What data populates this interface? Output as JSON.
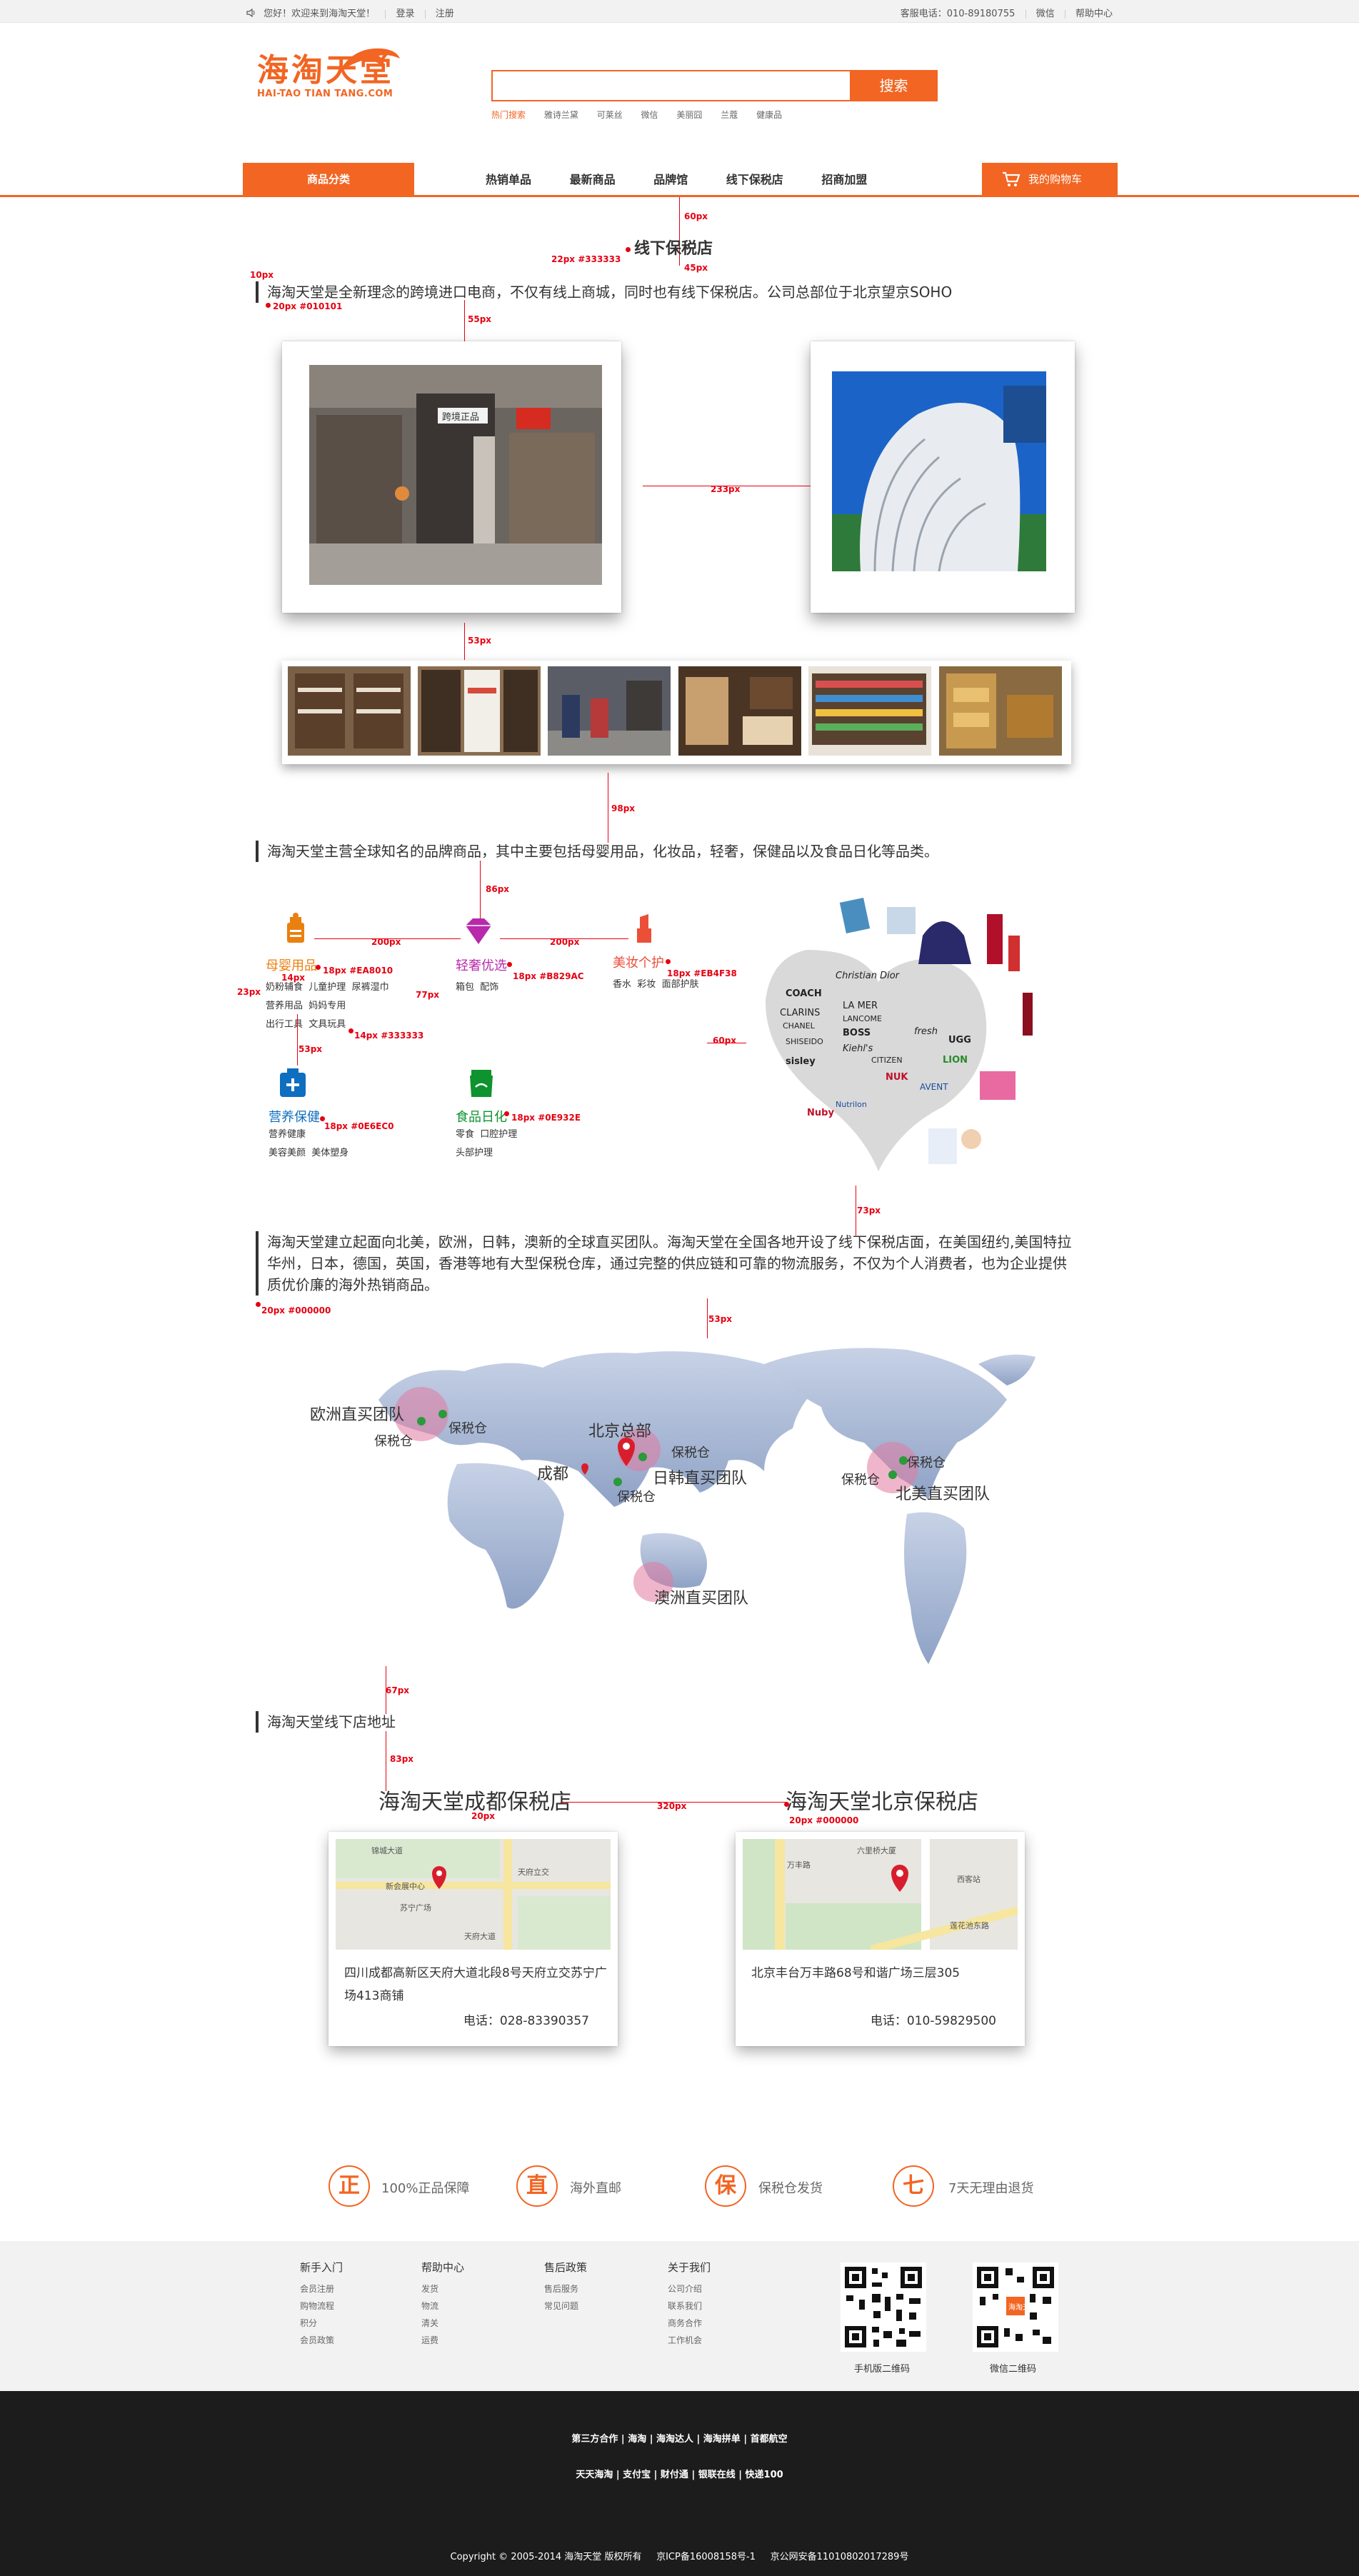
{
  "topbar": {
    "welcome": "您好！欢迎来到海淘天堂！",
    "login": "登录",
    "register": "注册",
    "service": "客服电话：010-89180755",
    "weixin": "微信",
    "help": "帮助中心"
  },
  "header": {
    "logo_text": "海淘天堂",
    "logo_sub": "HAI-TAO TIAN TANG.COM",
    "search_placeholder": "",
    "search_button": "搜索",
    "hot_words": [
      "热门搜索",
      "雅诗兰黛",
      "可莱丝",
      "微信",
      "美丽囧",
      "兰蔻",
      "健康品"
    ]
  },
  "nav": {
    "category": "商品分类",
    "items": [
      "热销单品",
      "最新商品",
      "品牌馆",
      "线下保税店",
      "招商加盟"
    ],
    "cart": "我的购物车"
  },
  "section1": {
    "title": "线下保税店",
    "intro": "海淘天堂是全新理念的跨境进口电商，不仅有线上商城，同时也有线下保税店。公司总部位于北京望京SOHO",
    "store_sign": "跨境正品"
  },
  "section2": {
    "intro": "海淘天堂主营全球知名的品牌商品，其中主要包括母婴用品，化妆品，轻奢，保健品以及食品日化等品类。",
    "categories": [
      {
        "name": "母婴用品",
        "subs": [
          "奶粉辅食",
          "儿童护理",
          "尿裤湿巾",
          "营养用品",
          "妈妈专用",
          "出行工具",
          "文具玩具"
        ],
        "color": "#EA8010"
      },
      {
        "name": "轻奢优选",
        "subs": [
          "箱包",
          "配饰"
        ],
        "color": "#B829AC"
      },
      {
        "name": "美妆个护",
        "subs": [
          "香水",
          "彩妆",
          "面部护肤"
        ],
        "color": "#EB4F38"
      },
      {
        "name": "营养保健",
        "subs": [
          "营养健康",
          "美容美颜",
          "美体塑身"
        ],
        "color": "#0E6EC0"
      },
      {
        "name": "食品日化",
        "subs": [
          "零食",
          "口腔护理",
          "头部护理"
        ],
        "color": "#0E932E"
      }
    ],
    "brands": [
      "Christian Dior",
      "COACH",
      "LA MER",
      "CLARINS",
      "LANCOME",
      "CHANEL",
      "BOSS",
      "SHISEIDO",
      "UGG",
      "LION",
      "sisley",
      "NUK",
      "CITIZEN",
      "AVENT",
      "Nutrilon",
      "Nuby",
      "Kiehl's",
      "fresh"
    ]
  },
  "section3": {
    "intro": "海淘天堂建立起面向北美，欧洲，日韩，澳新的全球直买团队。海淘天堂在全国各地开设了线下保税店面，在美国纽约,美国特拉华州，日本，德国，英国，香港等地有大型保税仓库，通过完整的供应链和可靠的物流服务，不仅为个人消费者，也为企业提供质优价廉的海外热销商品。",
    "map_labels": {
      "europe": "欧洲直买团队",
      "europe_wh1": "保税仓",
      "europe_wh2": "保税仓",
      "hq": "北京总部",
      "chengdu": "成都",
      "asia_wh1": "保税仓",
      "asia_wh2": "保税仓",
      "jk": "日韩直买团队",
      "na_wh1": "保税仓",
      "na_wh2": "保税仓",
      "na": "北美直买团队",
      "au": "澳洲直买团队"
    }
  },
  "section4": {
    "intro": "海淘天堂线下店地址",
    "stores": [
      {
        "name": "海淘天堂成都保税店",
        "address": "四川成都高新区天府大道北段8号天府立交苏宁广场413商铺",
        "tel": "电话：028-83390357",
        "map_labels": [
          "锦城大道",
          "天府立交",
          "苏宁广场",
          "天府大道",
          "新会展中心"
        ]
      },
      {
        "name": "海淘天堂北京保税店",
        "address": "北京丰台万丰路68号和谐广场三层305",
        "tel": "电话：010-59829500",
        "map_labels": [
          "六里桥大厦",
          "西客站",
          "莲花池东路",
          "万丰路"
        ]
      }
    ]
  },
  "guarantees": [
    {
      "icon": "正",
      "label": "100%正品保障"
    },
    {
      "icon": "直",
      "label": "海外直邮"
    },
    {
      "icon": "保",
      "label": "保税仓发货"
    },
    {
      "icon": "七",
      "label": "7天无理由退货"
    }
  ],
  "footer": {
    "cols": [
      {
        "title": "新手入门",
        "items": [
          "会员注册",
          "购物流程",
          "积分",
          "会员政策"
        ]
      },
      {
        "title": "帮助中心",
        "items": [
          "发货",
          "物流",
          "清关",
          "运费"
        ]
      },
      {
        "title": "售后政策",
        "items": [
          "售后服务",
          "常见问题"
        ]
      },
      {
        "title": "关于我们",
        "items": [
          "公司介绍",
          "联系我们",
          "商务合作",
          "工作机会"
        ]
      }
    ],
    "qr": [
      "手机版二维码",
      "微信二维码"
    ],
    "row1": "第三方合作 | 海淘 | 海淘达人 | 海淘拼单 | 首都航空",
    "row2": "天天海淘 | 支付宝 | 财付通 | 银联在线 | 快递100",
    "copyright": "Copyright © 2005-2014 海淘天堂 版权所有     京ICP备16008158号-1     京公网安备11010802017289号"
  },
  "annotations": {
    "a1": "60px",
    "a2": "22px #333333",
    "a3": "45px",
    "a4": "10px",
    "a5": "20px #010101",
    "a6": "55px",
    "a7": "233px",
    "a8": "53px",
    "a9": "98px",
    "a10": "86px",
    "a11": "200px",
    "a12": "200px",
    "a13": "18px #EA8010",
    "a14": "14px",
    "a15": "18px #B829AC",
    "a16": "18px #EB4F38",
    "a17": "23px",
    "a18": "77px",
    "a19": "14px #333333",
    "a20": "60px",
    "a21": "53px",
    "a22": "18px #0E6EC0",
    "a23": "18px #0E932E",
    "a24": "73px",
    "a25": "20px #000000",
    "a26": "53px",
    "a27": "67px",
    "a28": "83px",
    "a29": "20px",
    "a30": "320px",
    "a31": "20px #000000",
    "a32": "2px"
  },
  "colors": {
    "brand": "#f26522",
    "annotation": "#e60012",
    "footer_dark": "#1c1c1c"
  }
}
